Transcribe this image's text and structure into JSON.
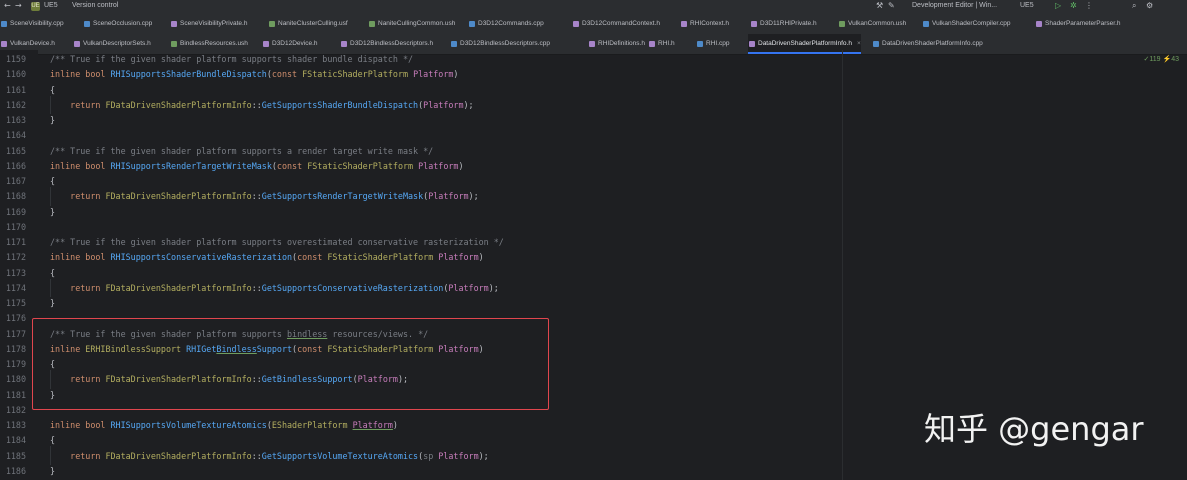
{
  "title_bar": {
    "project_badge": "UE",
    "project": "UE5",
    "vcs": "Version control",
    "config": "Development Editor | Win...",
    "target": "UE5"
  },
  "tabs_row1": [
    "SceneVisibility.cpp",
    "SceneOcclusion.cpp",
    "SceneVisibilityPrivate.h",
    "NaniteClusterCulling.usf",
    "NaniteCullingCommon.ush",
    "D3D12Commands.cpp",
    "D3D12CommandContext.h",
    "RHIContext.h",
    "D3D11RHIPrivate.h",
    "VulkanCommon.ush",
    "VulkanShaderCompiler.cpp",
    "ShaderParameterParser.h"
  ],
  "tabs_row2": [
    "VulkanDevice.h",
    "VulkanDescriptorSets.h",
    "BindlessResources.ush",
    "D3D12Device.h",
    "D3D12BindlessDescriptors.h",
    "D3D12BindlessDescriptors.cpp",
    "RHIDefinitions.h",
    "RHI.h",
    "RHI.cpp",
    "DataDrivenShaderPlatformInfo.h",
    "DataDrivenShaderPlatformInfo.cpp"
  ],
  "inspection": "✓119  ⚡43",
  "watermark": "知乎 @gengar",
  "code": [
    {
      "n": "1159",
      "t": [
        [
          "cm",
          "/** True if the given shader platform supports shader bundle dispatch */"
        ]
      ]
    },
    {
      "n": "1160",
      "t": [
        [
          "kw",
          "inline bool "
        ],
        [
          "fn",
          "RHISupportsShaderBundleDispatch"
        ],
        [
          "",
          "("
        ],
        [
          "kw",
          "const "
        ],
        [
          "ty",
          "FStaticShaderPlatform "
        ],
        [
          "pr",
          "Platform"
        ],
        [
          "",
          ")"
        ]
      ]
    },
    {
      "n": "1161",
      "t": [
        [
          "",
          "{"
        ]
      ]
    },
    {
      "n": "1162",
      "t": [
        [
          "",
          "    "
        ],
        [
          "kw",
          "return "
        ],
        [
          "ty",
          "FDataDrivenShaderPlatformInfo"
        ],
        [
          "",
          "::"
        ],
        [
          "fn",
          "GetSupportsShaderBundleDispatch"
        ],
        [
          "",
          "("
        ],
        [
          "pr",
          "Platform"
        ],
        [
          "",
          ");"
        ]
      ]
    },
    {
      "n": "1163",
      "t": [
        [
          "",
          "}"
        ]
      ]
    },
    {
      "n": "1164",
      "t": []
    },
    {
      "n": "1165",
      "t": [
        [
          "cm",
          "/** True if the given shader platform supports a render target write mask */"
        ]
      ]
    },
    {
      "n": "1166",
      "t": [
        [
          "kw",
          "inline bool "
        ],
        [
          "fn",
          "RHISupportsRenderTargetWriteMask"
        ],
        [
          "",
          "("
        ],
        [
          "kw",
          "const "
        ],
        [
          "ty",
          "FStaticShaderPlatform "
        ],
        [
          "pr",
          "Platform"
        ],
        [
          "",
          ")"
        ]
      ]
    },
    {
      "n": "1167",
      "t": [
        [
          "",
          "{"
        ]
      ]
    },
    {
      "n": "1168",
      "t": [
        [
          "",
          "    "
        ],
        [
          "kw",
          "return "
        ],
        [
          "ty",
          "FDataDrivenShaderPlatformInfo"
        ],
        [
          "",
          "::"
        ],
        [
          "fn",
          "GetSupportsRenderTargetWriteMask"
        ],
        [
          "",
          "("
        ],
        [
          "pr",
          "Platform"
        ],
        [
          "",
          ");"
        ]
      ]
    },
    {
      "n": "1169",
      "t": [
        [
          "",
          "}"
        ]
      ]
    },
    {
      "n": "1170",
      "t": []
    },
    {
      "n": "1171",
      "t": [
        [
          "cm",
          "/** True if the given shader platform supports overestimated conservative rasterization */"
        ]
      ]
    },
    {
      "n": "1172",
      "t": [
        [
          "kw",
          "inline bool "
        ],
        [
          "fn",
          "RHISupportsConservativeRasterization"
        ],
        [
          "",
          "("
        ],
        [
          "kw",
          "const "
        ],
        [
          "ty",
          "FStaticShaderPlatform "
        ],
        [
          "pr",
          "Platform"
        ],
        [
          "",
          ")"
        ]
      ]
    },
    {
      "n": "1173",
      "t": [
        [
          "",
          "{"
        ]
      ]
    },
    {
      "n": "1174",
      "t": [
        [
          "",
          "    "
        ],
        [
          "kw",
          "return "
        ],
        [
          "ty",
          "FDataDrivenShaderPlatformInfo"
        ],
        [
          "",
          "::"
        ],
        [
          "fn",
          "GetSupportsConservativeRasterization"
        ],
        [
          "",
          "("
        ],
        [
          "pr",
          "Platform"
        ],
        [
          "",
          ");"
        ]
      ]
    },
    {
      "n": "1175",
      "t": [
        [
          "",
          "}"
        ]
      ]
    },
    {
      "n": "1176",
      "t": []
    },
    {
      "n": "1177",
      "t": [
        [
          "cm",
          "/** True if the given shader platform supports "
        ],
        [
          "cm ul",
          "bindless"
        ],
        [
          "cm",
          " resources/views. */"
        ]
      ]
    },
    {
      "n": "1178",
      "t": [
        [
          "kw",
          "inline "
        ],
        [
          "ty",
          "ERHIBindlessSupport "
        ],
        [
          "fn",
          "RHIGet"
        ],
        [
          "fn ul",
          "Bindless"
        ],
        [
          "fn",
          "Support"
        ],
        [
          "",
          "("
        ],
        [
          "kw",
          "const "
        ],
        [
          "ty",
          "FStaticShaderPlatform "
        ],
        [
          "pr",
          "Platform"
        ],
        [
          "",
          ")"
        ]
      ]
    },
    {
      "n": "1179",
      "t": [
        [
          "",
          "{"
        ]
      ]
    },
    {
      "n": "1180",
      "t": [
        [
          "",
          "    "
        ],
        [
          "kw",
          "return "
        ],
        [
          "ty",
          "FDataDrivenShaderPlatformInfo"
        ],
        [
          "",
          "::"
        ],
        [
          "fn",
          "GetBindlessSupport"
        ],
        [
          "",
          "("
        ],
        [
          "pr",
          "Platform"
        ],
        [
          "",
          ");"
        ]
      ]
    },
    {
      "n": "1181",
      "t": [
        [
          "",
          "}"
        ]
      ]
    },
    {
      "n": "1182",
      "t": []
    },
    {
      "n": "1183",
      "t": [
        [
          "kw",
          "inline bool "
        ],
        [
          "fn",
          "RHISupportsVolumeTextureAtomics"
        ],
        [
          "",
          "("
        ],
        [
          "ty",
          "EShaderPlatform "
        ],
        [
          "pr ul",
          "Platform"
        ],
        [
          "",
          ")"
        ]
      ]
    },
    {
      "n": "1184",
      "t": [
        [
          "",
          "{"
        ]
      ]
    },
    {
      "n": "1185",
      "t": [
        [
          "",
          "    "
        ],
        [
          "kw",
          "return "
        ],
        [
          "ty",
          "FDataDrivenShaderPlatformInfo"
        ],
        [
          "",
          "::"
        ],
        [
          "fn",
          "GetSupportsVolumeTextureAtomics"
        ],
        [
          "",
          "("
        ],
        [
          "cm",
          "sp "
        ],
        [
          "pr",
          "Platform"
        ],
        [
          "",
          ");"
        ]
      ]
    },
    {
      "n": "1186",
      "t": [
        [
          "",
          "}"
        ]
      ]
    }
  ]
}
